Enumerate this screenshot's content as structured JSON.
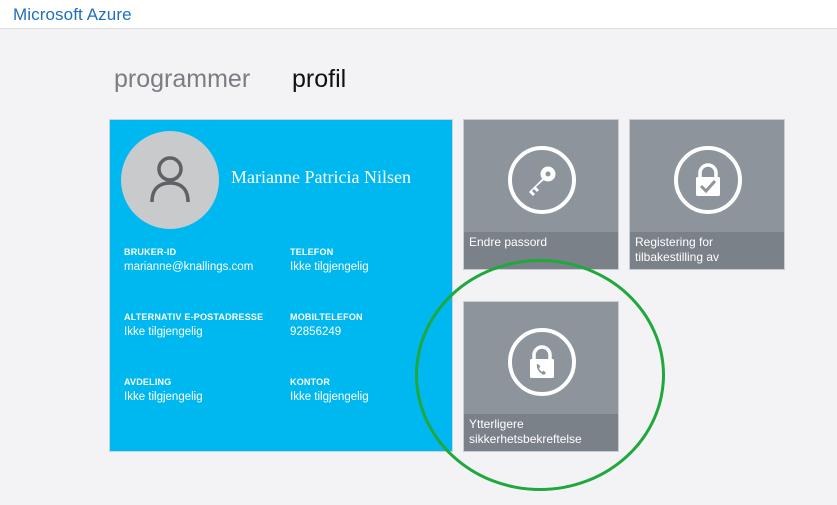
{
  "header": {
    "brand": "Microsoft Azure"
  },
  "tabs": [
    {
      "label": "programmer",
      "active": false
    },
    {
      "label": "profil",
      "active": true
    }
  ],
  "profile": {
    "name": "Marianne Patricia Nilsen",
    "fields": [
      {
        "label": "BRUKER-ID",
        "value": "marianne@knallings.com"
      },
      {
        "label": "TELEFON",
        "value": "Ikke tilgjengelig"
      },
      {
        "label": "ALTERNATIV E-POSTADRESSE",
        "value": "Ikke tilgjengelig"
      },
      {
        "label": "MOBILTELEFON",
        "value": "92856249"
      },
      {
        "label": "AVDELING",
        "value": "Ikke tilgjengelig"
      },
      {
        "label": "KONTOR",
        "value": "Ikke tilgjengelig"
      }
    ]
  },
  "tiles": [
    {
      "label": "Endre passord",
      "icon": "key-icon"
    },
    {
      "label": "Registering for tilbakestilling av",
      "icon": "lock-check-icon"
    },
    {
      "label": "Ytterligere sikkerhetsbekreftelse",
      "icon": "lock-phone-icon"
    }
  ],
  "colors": {
    "brand": "#1f6fbf",
    "profile_card": "#00b8f0",
    "tile": "#8d949c",
    "tile_label_bar": "#7b8189",
    "highlight": "#1fa83c"
  }
}
